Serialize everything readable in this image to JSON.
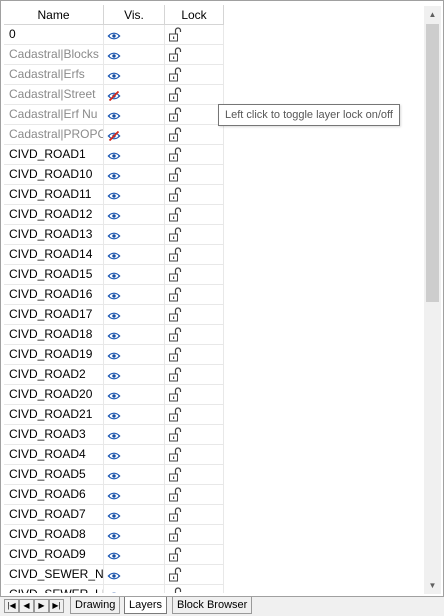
{
  "columns": {
    "name": "Name",
    "vis": "Vis.",
    "lock": "Lock"
  },
  "layers": [
    {
      "name": "0",
      "visible": true,
      "dim": false
    },
    {
      "name": "Cadastral|Blocks",
      "visible": true,
      "dim": true
    },
    {
      "name": "Cadastral|Erfs",
      "visible": true,
      "dim": true
    },
    {
      "name": "Cadastral|Street",
      "visible": false,
      "dim": true
    },
    {
      "name": "Cadastral|Erf Nu",
      "visible": true,
      "dim": true
    },
    {
      "name": "Cadastral|PROPC",
      "visible": false,
      "dim": true
    },
    {
      "name": "CIVD_ROAD1",
      "visible": true,
      "dim": false
    },
    {
      "name": "CIVD_ROAD10",
      "visible": true,
      "dim": false
    },
    {
      "name": "CIVD_ROAD11",
      "visible": true,
      "dim": false
    },
    {
      "name": "CIVD_ROAD12",
      "visible": true,
      "dim": false
    },
    {
      "name": "CIVD_ROAD13",
      "visible": true,
      "dim": false
    },
    {
      "name": "CIVD_ROAD14",
      "visible": true,
      "dim": false
    },
    {
      "name": "CIVD_ROAD15",
      "visible": true,
      "dim": false
    },
    {
      "name": "CIVD_ROAD16",
      "visible": true,
      "dim": false
    },
    {
      "name": "CIVD_ROAD17",
      "visible": true,
      "dim": false
    },
    {
      "name": "CIVD_ROAD18",
      "visible": true,
      "dim": false
    },
    {
      "name": "CIVD_ROAD19",
      "visible": true,
      "dim": false
    },
    {
      "name": "CIVD_ROAD2",
      "visible": true,
      "dim": false
    },
    {
      "name": "CIVD_ROAD20",
      "visible": true,
      "dim": false
    },
    {
      "name": "CIVD_ROAD21",
      "visible": true,
      "dim": false
    },
    {
      "name": "CIVD_ROAD3",
      "visible": true,
      "dim": false
    },
    {
      "name": "CIVD_ROAD4",
      "visible": true,
      "dim": false
    },
    {
      "name": "CIVD_ROAD5",
      "visible": true,
      "dim": false
    },
    {
      "name": "CIVD_ROAD6",
      "visible": true,
      "dim": false
    },
    {
      "name": "CIVD_ROAD7",
      "visible": true,
      "dim": false
    },
    {
      "name": "CIVD_ROAD8",
      "visible": true,
      "dim": false
    },
    {
      "name": "CIVD_ROAD9",
      "visible": true,
      "dim": false
    },
    {
      "name": "CIVD_SEWER_NO",
      "visible": true,
      "dim": false
    },
    {
      "name": "CIVD_SEWER_LI",
      "visible": true,
      "dim": false
    }
  ],
  "tooltip": "Left click to toggle layer lock on/off",
  "tabs": [
    "Drawing",
    "Layers",
    "Block Browser"
  ],
  "active_tab": "Layers",
  "icons": {
    "visible": "eye-icon",
    "hidden": "eye-crossed-icon",
    "lock": "unlocked-padlock-icon",
    "nav": [
      "first-icon",
      "prev-icon",
      "next-icon",
      "last-icon"
    ]
  },
  "colors": {
    "eye": "#2b6fd6",
    "hidden_slash": "#d0271d",
    "dim_text": "#8a8a8a"
  }
}
